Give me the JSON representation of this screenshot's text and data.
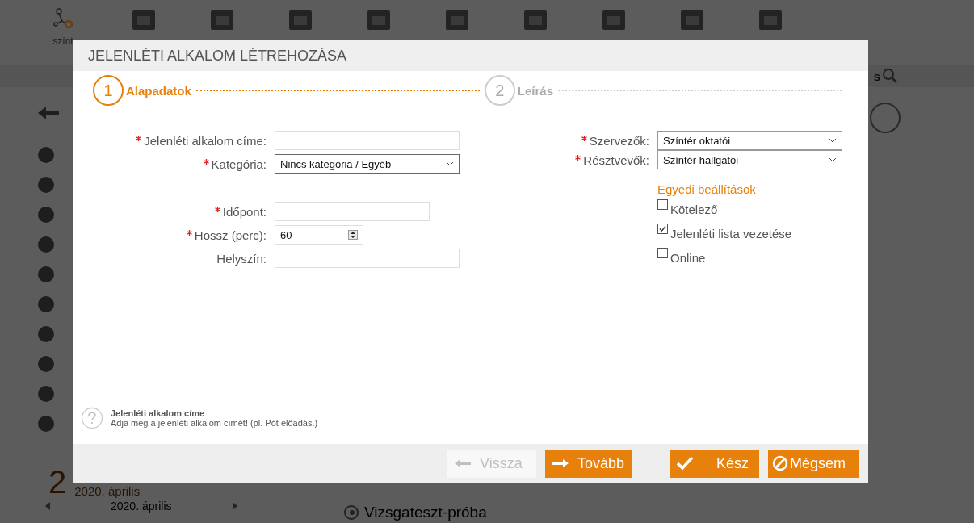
{
  "background": {
    "toolbar_label": "színt",
    "search_text": "s",
    "day": "2",
    "month_heading": "2020. április",
    "month_nav": "2020. április",
    "event_title": "Vizsgateszt-próba"
  },
  "dialog": {
    "title": "JELENLÉTI ALKALOM LÉTREHOZÁSA",
    "steps": [
      {
        "number": "1",
        "label": "Alapadatok",
        "selected": true
      },
      {
        "number": "2",
        "label": "Leírás",
        "selected": false
      }
    ],
    "left_groups": [
      [
        {
          "label": "Jelenléti alkalom címe:",
          "required": true,
          "kind": "text"
        },
        {
          "label": "Kategória:",
          "required": true,
          "kind": "select",
          "value": "Nincs kategória / Egyéb"
        }
      ],
      [
        {
          "label": "Időpont:",
          "required": true,
          "kind": "datetime"
        },
        {
          "label": "Hossz (perc):",
          "required": true,
          "kind": "number",
          "value": "60"
        },
        {
          "label": "Helyszín:",
          "required": false,
          "kind": "text"
        }
      ]
    ],
    "right_fields": [
      {
        "label": "Szervezők:",
        "required": true,
        "kind": "select",
        "value": "Színtér oktatói"
      },
      {
        "label": "Résztvevők:",
        "required": true,
        "kind": "select",
        "value": "Színtér hallgatói"
      }
    ],
    "options_heading": "Egyedi beállítások",
    "options": [
      {
        "label": "Kötelező",
        "checked": false
      },
      {
        "label": "Jelenléti lista vezetése",
        "checked": true
      },
      {
        "label": "Online",
        "checked": false
      }
    ],
    "help": {
      "title": "Jelenléti alkalom címe",
      "text": "Adja meg a jelenléti alkalom címét! (pl. Pót előadás.)"
    },
    "buttons": [
      {
        "label": "Vissza",
        "kind": "back",
        "disabled": true
      },
      {
        "label": "Tovább",
        "kind": "next",
        "disabled": false
      },
      {
        "label": "Kész",
        "kind": "done",
        "disabled": false
      },
      {
        "label": "Mégsem",
        "kind": "cancel",
        "disabled": false
      }
    ]
  }
}
